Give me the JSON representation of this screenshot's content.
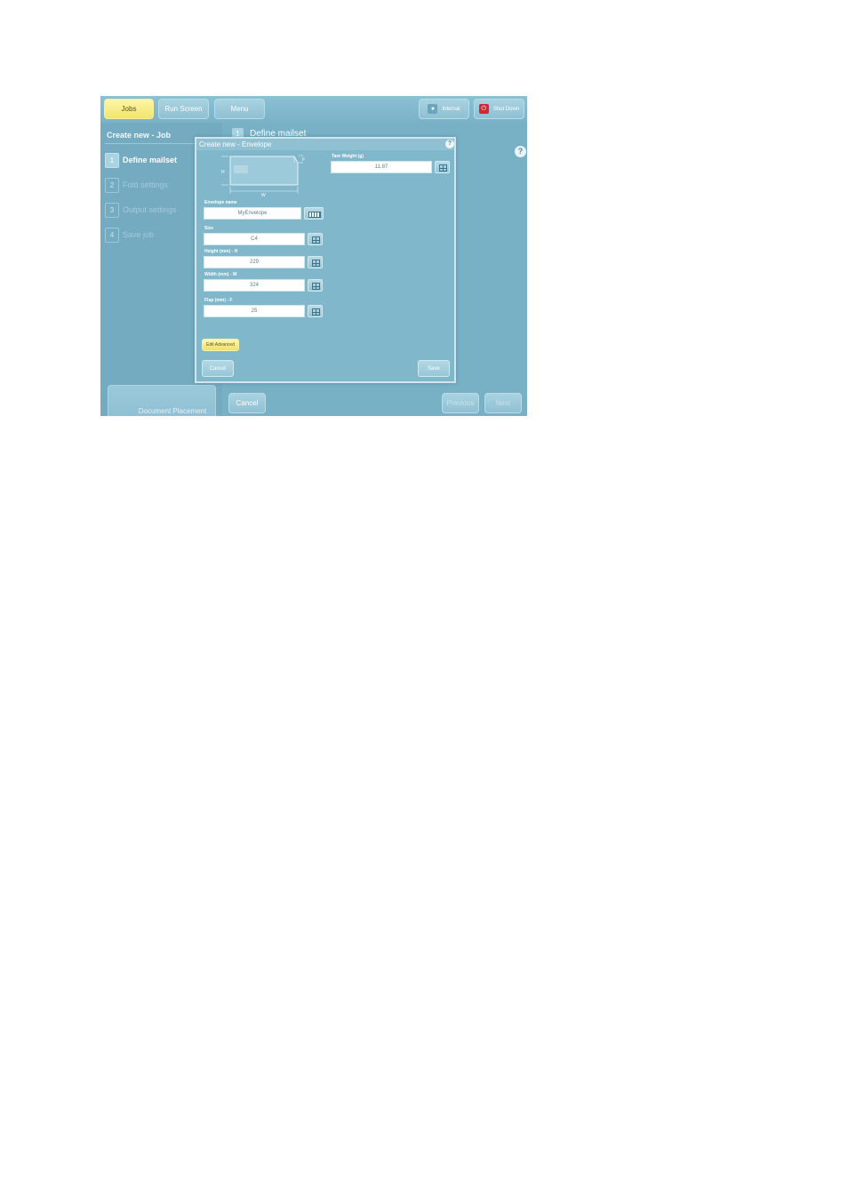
{
  "topbar": {
    "jobs_label": "Jobs",
    "run_screen_label": "Run Screen",
    "menu_label": "Menu",
    "internal_label": "Internal",
    "shut_down_label": "Shut Down"
  },
  "left_panel": {
    "title": "Create new - Job",
    "steps": [
      {
        "num": "1",
        "label": "Define mailset"
      },
      {
        "num": "2",
        "label": "Fold settings"
      },
      {
        "num": "3",
        "label": "Output settings"
      },
      {
        "num": "4",
        "label": "Save job"
      }
    ],
    "document_placement_label": "Document Placement"
  },
  "main": {
    "step_num": "1",
    "step_title": "Define mailset",
    "help": "?",
    "cancel_label": "Cancel",
    "previous_label": "Previous",
    "next_label": "Next"
  },
  "dialog": {
    "title": "Create new - Envelope",
    "help": "?",
    "diagram": {
      "h": "H",
      "w": "W",
      "f": "F"
    },
    "tare_weight": {
      "label": "Tare Weight (g)",
      "value": "11.87"
    },
    "envelope_name": {
      "label": "Envelope name",
      "value": "MyEnvelope"
    },
    "size": {
      "label": "Size",
      "value": "C4"
    },
    "height": {
      "label": "Height (mm) - H",
      "value": "229"
    },
    "width": {
      "label": "Width (mm) - W",
      "value": "324"
    },
    "flap": {
      "label": "Flap (mm) - F",
      "value": "25"
    },
    "edit_advanced_label": "Edit Advanced",
    "cancel_label": "Cancel",
    "save_label": "Save"
  }
}
